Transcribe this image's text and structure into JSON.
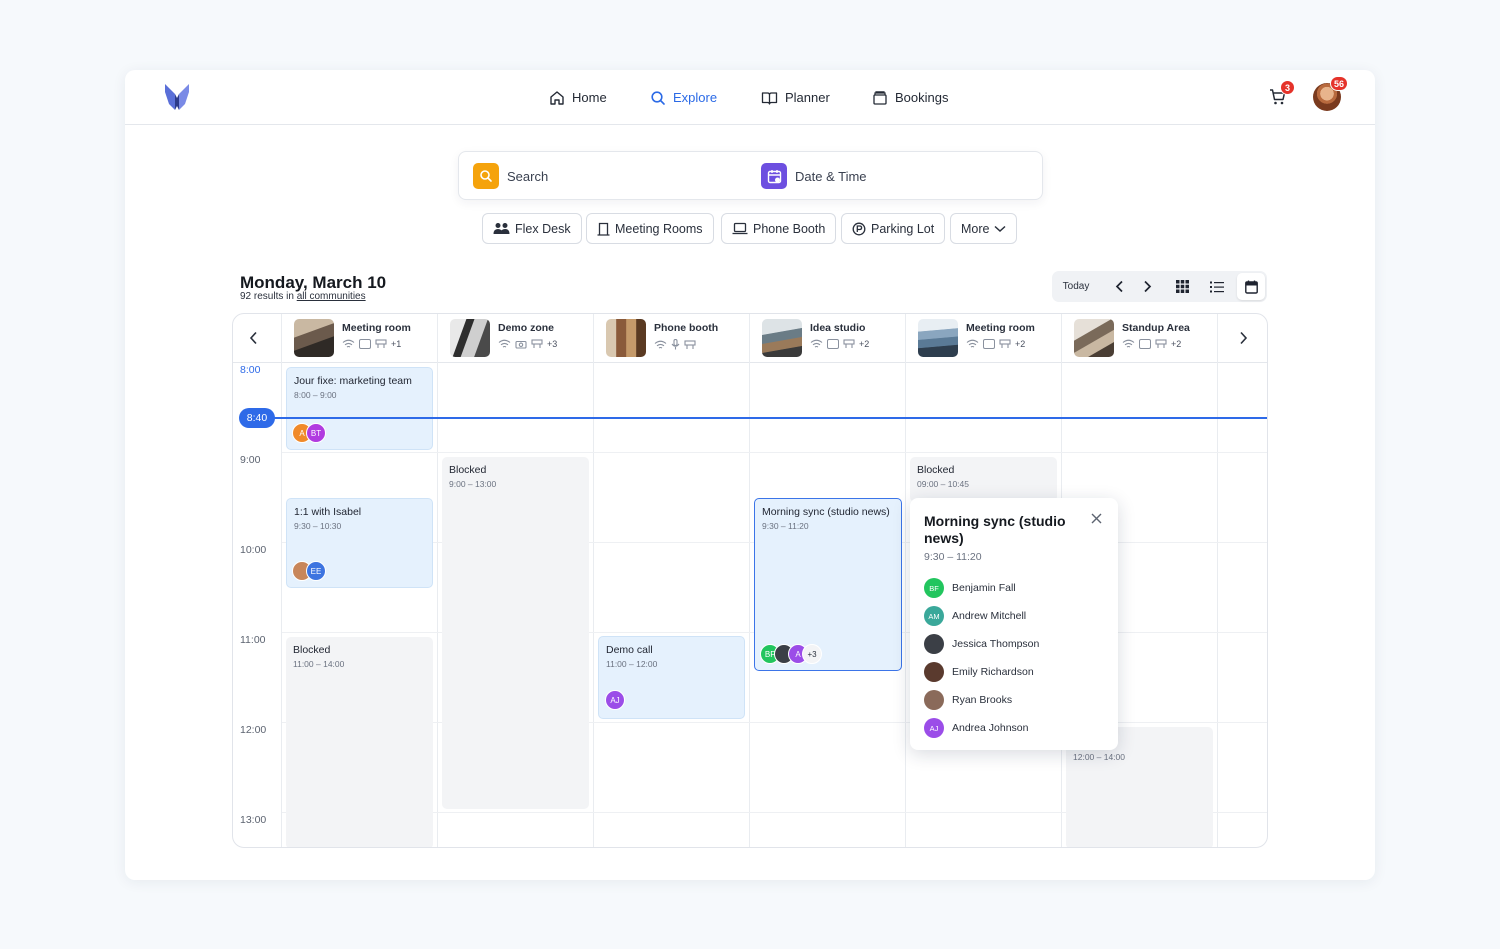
{
  "nav": {
    "home": "Home",
    "explore": "Explore",
    "planner": "Planner",
    "bookings": "Bookings",
    "cart_count": "3",
    "notif_count": "56"
  },
  "search": {
    "search_label": "Search",
    "datetime_label": "Date & Time"
  },
  "filters": [
    "Flex Desk",
    "Meeting Rooms",
    "Phone Booth",
    "Parking Lot",
    "More"
  ],
  "header": {
    "date": "Monday, March 10",
    "results_prefix": "92 results in ",
    "results_link": "all communities",
    "today": "Today"
  },
  "resources": [
    {
      "name": "Meeting room",
      "extra": "+1",
      "color": "#6b5a4c"
    },
    {
      "name": "Demo zone",
      "extra": "+3",
      "color": "#4a4a4a"
    },
    {
      "name": "Phone booth",
      "extra": "",
      "color": "#8a5a3a"
    },
    {
      "name": "Idea studio",
      "extra": "+2",
      "color": "#6a7c86"
    },
    {
      "name": "Meeting room",
      "extra": "+2",
      "color": "#5a7a96"
    },
    {
      "name": "Standup Area",
      "extra": "+2",
      "color": "#7a6a5a"
    }
  ],
  "times": [
    "8:00",
    "9:00",
    "10:00",
    "11:00",
    "12:00",
    "13:00"
  ],
  "now": "8:40",
  "events": {
    "jour_fixe": {
      "title": "Jour fixe: marketing team",
      "hours": "8:00 – 9:00",
      "av1": "A",
      "av2": "BT"
    },
    "isabel": {
      "title": "1:1 with Isabel",
      "hours": "9:30 – 10:30",
      "av2": "EE"
    },
    "blocked1": {
      "title": "Blocked",
      "hours": "11:00 – 14:00"
    },
    "blocked2": {
      "title": "Blocked",
      "hours": "9:00 – 13:00"
    },
    "demo_call": {
      "title": "Demo call",
      "hours": "11:00 – 12:00",
      "av1": "AJ"
    },
    "morning_sync": {
      "title": "Morning sync (studio news)",
      "hours": "9:30 – 11:20",
      "av1": "BF",
      "av3": "A",
      "more": "+3"
    },
    "blocked3": {
      "title": "Blocked",
      "hours": "09:00 – 10:45"
    },
    "standup": {
      "hours": "12:00 – 14:00"
    }
  },
  "popover": {
    "title": "Morning sync (studio news)",
    "hours": "9:30 – 11:20",
    "attendees": [
      {
        "initials": "BF",
        "name": "Benjamin Fall",
        "color": "#22c55e"
      },
      {
        "initials": "AM",
        "name": "Andrew Mitchell",
        "color": "#3aa89a"
      },
      {
        "initials": "",
        "name": "Jessica Thompson",
        "color": "#3b3f46"
      },
      {
        "initials": "",
        "name": "Emily Richardson",
        "color": "#5a3a2e"
      },
      {
        "initials": "",
        "name": "Ryan Brooks",
        "color": "#8a6a5a"
      },
      {
        "initials": "AJ",
        "name": "Andrea Johnson",
        "color": "#9b4de8"
      }
    ]
  }
}
